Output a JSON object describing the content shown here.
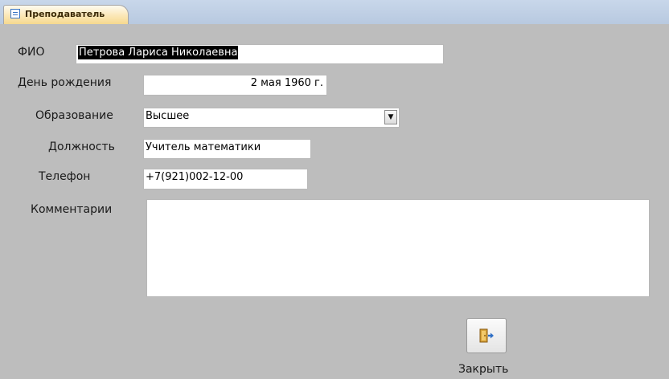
{
  "tab": {
    "title": "Преподаватель",
    "icon": "form-icon"
  },
  "form": {
    "fio": {
      "label": "ФИО",
      "value": "Петрова Лариса Николаевна"
    },
    "birthday": {
      "label": "День рождения",
      "value": "2 мая 1960 г."
    },
    "education": {
      "label": "Образование",
      "value": "Высшее",
      "dropdown_icon": "chevron-down-icon"
    },
    "position": {
      "label": "Должность",
      "value": "Учитель математики"
    },
    "phone": {
      "label": "Телефон",
      "value": "+7(921)002-12-00"
    },
    "comments": {
      "label": "Комментарии",
      "value": ""
    }
  },
  "close_button": {
    "label": "Закрыть",
    "icon": "exit-door-icon"
  },
  "colors": {
    "form_background": "#bdbdbd",
    "tab_active": "#fbe7b6",
    "tab_strip": "#c8d7ea"
  }
}
